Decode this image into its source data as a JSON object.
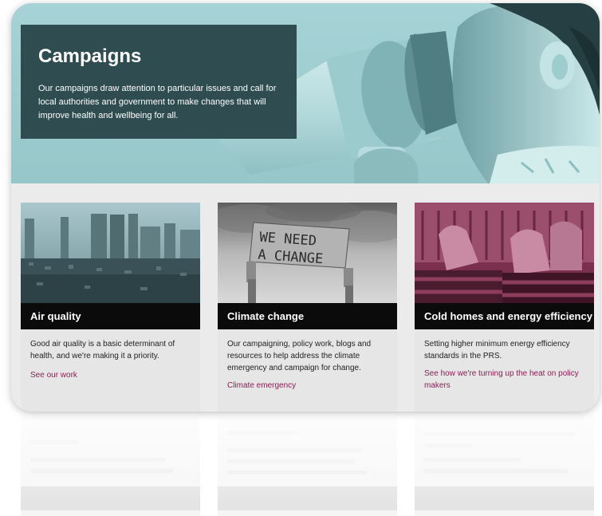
{
  "hero": {
    "title": "Campaigns",
    "text": "Our campaigns draw attention to particular issues and call for local authorities and government to make changes that will improve health and wellbeing for all.",
    "image_icon": "megaphone-child-photo"
  },
  "cards": [
    {
      "title": "Air quality",
      "description": "Good air quality is a basic determinant of health, and we're making it a priority.",
      "link": "See our work",
      "image_icon": "city-skyline-photo"
    },
    {
      "title": "Climate change",
      "description": "Our campaigning, policy work, blogs and resources to help address the climate emergency and campaign for change.",
      "link": "Climate emergency",
      "image_icon": "protest-sign-photo",
      "sign_text_line1": "WE NEED",
      "sign_text_line2": "A CHANGE"
    },
    {
      "title": "Cold homes and energy efficiency",
      "description": "Setting higher minimum energy efficiency standards in the PRS.",
      "link": "See how we're turning up the heat on policy makers",
      "image_icon": "hands-on-radiator-photo"
    }
  ],
  "colors": {
    "hero_bg": "#a6d3d6",
    "hero_box": "#2f4c50",
    "card_bar": "#0b0b0b",
    "link": "#8a1e55",
    "card_bg": "#e6e6e6"
  }
}
